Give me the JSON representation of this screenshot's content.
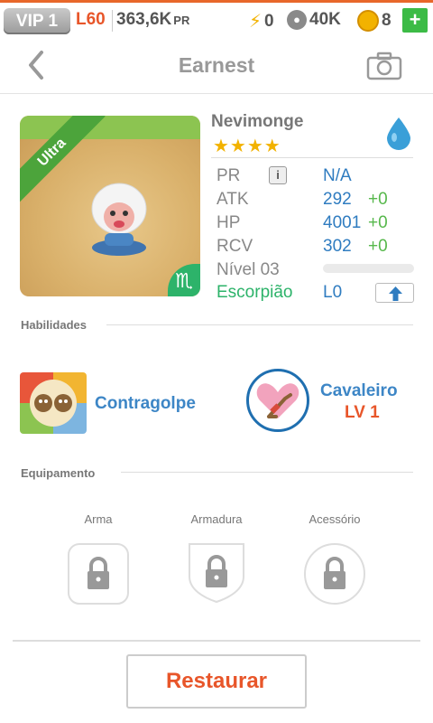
{
  "status_bar": {
    "vip": "VIP 1",
    "level": "L60",
    "pr_value": "363,6K",
    "pr_unit": "PR",
    "energy": "0",
    "paws": "40K",
    "coins": "8",
    "plus_label": "+"
  },
  "header": {
    "title": "Earnest"
  },
  "monster": {
    "name": "Nevimonge",
    "stars": "★★★★",
    "rarity_ribbon": "Ultra",
    "element_icon": "water-drop-icon",
    "zodiac_symbol": "♏",
    "stats": [
      {
        "label": "PR",
        "value": "N/A",
        "bonus": ""
      },
      {
        "label": "ATK",
        "value": "292",
        "bonus": "+0"
      },
      {
        "label": "HP",
        "value": "4001",
        "bonus": "+0"
      },
      {
        "label": "RCV",
        "value": "302",
        "bonus": "+0"
      }
    ],
    "level_label": "Nível 03",
    "xp_progress": 0,
    "zodiac_label": "Escorpião",
    "zodiac_level": "L0"
  },
  "abilities": {
    "section_title": "Habilidades",
    "items": [
      {
        "name": "Contragolpe",
        "level": ""
      },
      {
        "name": "Cavaleiro",
        "level": "LV 1"
      }
    ]
  },
  "equipment": {
    "section_title": "Equipamento",
    "slots": [
      {
        "label": "Arma",
        "shape": "rounded-square"
      },
      {
        "label": "Armadura",
        "shape": "shield"
      },
      {
        "label": "Acessório",
        "shape": "circle"
      }
    ]
  },
  "actions": {
    "restore_label": "Restaurar"
  },
  "colors": {
    "accent_orange": "#e8562a",
    "stat_blue": "#2f7cc0",
    "bonus_green": "#57b84c",
    "zodiac_green": "#2db36a",
    "star_gold": "#f2b200"
  }
}
